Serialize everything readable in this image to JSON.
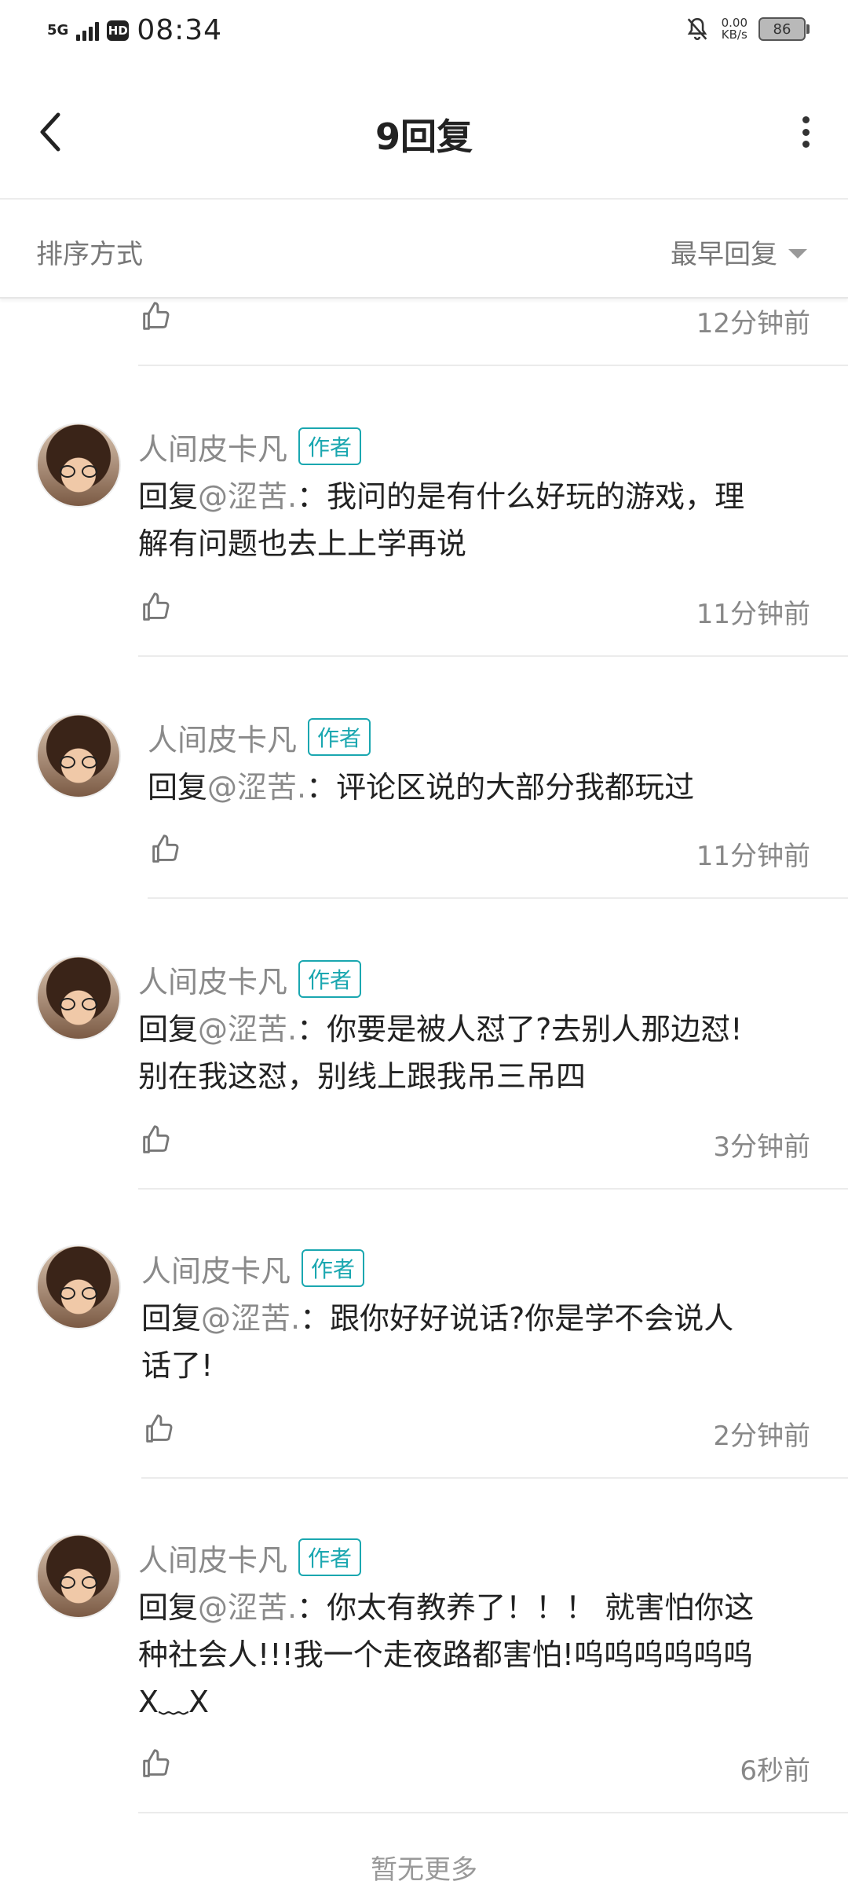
{
  "status_bar": {
    "network": "5G",
    "hd": "HD",
    "time": "08:34",
    "speed_value": "0.00",
    "speed_unit": "KB/s",
    "battery": "86"
  },
  "header": {
    "title": "9回复"
  },
  "sort": {
    "label": "排序方式",
    "value": "最早回复"
  },
  "top_partial_item": {
    "time": "12分钟前"
  },
  "comments": [
    {
      "name": "人间皮卡凡",
      "badge": "作者",
      "reply_prefix": "回复",
      "mention": "@涩苦.",
      "text_line1": "：我问的是有什么好玩的游戏，理",
      "text_line2": "解有问题也去上上学再说",
      "text_line3": "",
      "time": "11分钟前"
    },
    {
      "name": "人间皮卡凡",
      "badge": "作者",
      "reply_prefix": "回复",
      "mention": "@涩苦.",
      "text_line1": "：评论区说的大部分我都玩过",
      "text_line2": "",
      "text_line3": "",
      "time": "11分钟前"
    },
    {
      "name": "人间皮卡凡",
      "badge": "作者",
      "reply_prefix": "回复",
      "mention": "@涩苦.",
      "text_line1": "：你要是被人怼了?去别人那边怼!",
      "text_line2": "别在我这怼，别线上跟我吊三吊四",
      "text_line3": "",
      "time": "3分钟前"
    },
    {
      "name": "人间皮卡凡",
      "badge": "作者",
      "reply_prefix": "回复",
      "mention": "@涩苦.",
      "text_line1": "：跟你好好说话?你是学不会说人",
      "text_line2": "话了!",
      "text_line3": "",
      "time": "2分钟前"
    },
    {
      "name": "人间皮卡凡",
      "badge": "作者",
      "reply_prefix": "回复",
      "mention": "@涩苦.",
      "text_line1": "：你太有教养了！！！ 就害怕你这",
      "text_line2": "种社会人!!!我一个走夜路都害怕!呜呜呜呜呜呜",
      "text_line3": "X﹏X",
      "time": "6秒前"
    }
  ],
  "footer": {
    "no_more": "暂无更多"
  },
  "icons": {
    "back": "chevron-left-icon",
    "more": "more-vertical-icon",
    "like": "thumbs-up-icon",
    "mute": "bell-off-icon",
    "sort_caret": "caret-down-icon"
  },
  "colors": {
    "author_badge": "#1aa7b0",
    "mention": "#8a8a8a",
    "divider": "#ebebeb"
  }
}
